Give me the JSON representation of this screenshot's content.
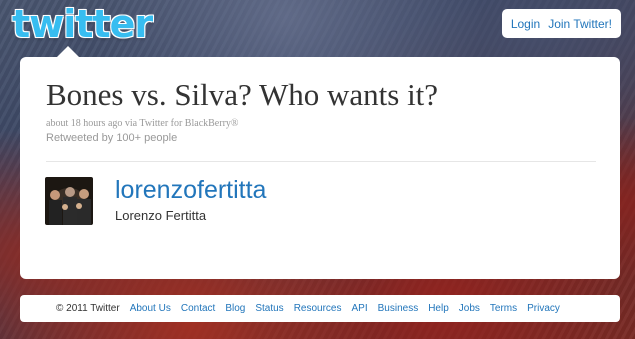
{
  "logo": {
    "text": "twitter"
  },
  "auth": {
    "login": "Login",
    "join": "Join Twitter!"
  },
  "tweet": {
    "text": "Bones vs. Silva? Who wants it?",
    "meta": "about 18 hours ago via Twitter for BlackBerry®",
    "retweets": "Retweeted by 100+ people"
  },
  "author": {
    "username": "lorenzofertitta",
    "fullname": "Lorenzo Fertitta"
  },
  "footer": {
    "copyright": "© 2011 Twitter",
    "links": [
      "About Us",
      "Contact",
      "Blog",
      "Status",
      "Resources",
      "API",
      "Business",
      "Help",
      "Jobs",
      "Terms",
      "Privacy"
    ]
  }
}
